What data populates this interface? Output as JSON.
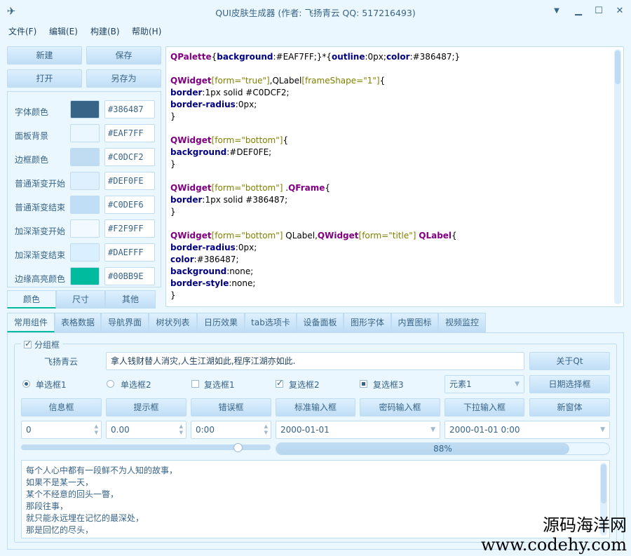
{
  "window": {
    "title": "QUI皮肤生成器 (作者: 飞扬青云  QQ: 517216493)",
    "icons": {
      "app": "airplane-icon",
      "minimize": "minimize-icon",
      "restore": "restore-icon",
      "maximize": "maximize-icon",
      "close": "close-icon"
    }
  },
  "menu": [
    "文件(F)",
    "编辑(E)",
    "构建(B)",
    "帮助(H)"
  ],
  "actions": {
    "new": "新建",
    "save": "保存",
    "open": "打开",
    "save_as": "另存为"
  },
  "colors": [
    {
      "label": "字体颜色",
      "hex": "#386487"
    },
    {
      "label": "面板背景",
      "hex": "#EAF7FF"
    },
    {
      "label": "边框颜色",
      "hex": "#C0DCF2"
    },
    {
      "label": "普通渐变开始",
      "hex": "#DEF0FE"
    },
    {
      "label": "普通渐变结束",
      "hex": "#C0DEF6"
    },
    {
      "label": "加深渐变开始",
      "hex": "#F2F9FF"
    },
    {
      "label": "加深渐变结束",
      "hex": "#DAEFFF"
    },
    {
      "label": "边缘高亮颜色",
      "hex": "#00BB9E"
    }
  ],
  "left_tabs": [
    "颜色",
    "尺寸",
    "其他"
  ],
  "code_lines": [
    "QPalette{background:#EAF7FF;}*{outline:0px;color:#386487;}",
    "",
    "QWidget[form=\"true\"],QLabel[frameShape=\"1\"]{",
    "border:1px solid #C0DCF2;",
    "border-radius:0px;",
    "}",
    "",
    "QWidget[form=\"bottom\"]{",
    "background:#DEF0FE;",
    "}",
    "",
    "QWidget[form=\"bottom\"] .QFrame{",
    "border:1px solid #386487;",
    "}",
    "",
    "QWidget[form=\"bottom\"] QLabel,QWidget[form=\"title\"] QLabel{",
    "border-radius:0px;",
    "color:#386487;",
    "background:none;",
    "border-style:none;",
    "}"
  ],
  "main_tabs": [
    "常用组件",
    "表格数据",
    "导航界面",
    "树状列表",
    "日历效果",
    "tab选项卡",
    "设备面板",
    "图形字体",
    "内置图标",
    "视频监控"
  ],
  "group": {
    "title": "分组框",
    "name_label": "飞扬青云",
    "motto": "拿人钱财替人消灾,人生江湖如此,程序江湖亦如此.",
    "about_button": "关于Qt",
    "radio1": "单选框1",
    "radio2": "单选框2",
    "check1": "复选框1",
    "check2": "复选框2",
    "check3": "复选框3",
    "combo_value": "元素1",
    "date_picker_button": "日期选择框",
    "dialog_buttons": [
      "信息框",
      "提示框",
      "错误框",
      "标准输入框",
      "密码输入框",
      "下拉输入框",
      "新窗体"
    ],
    "spin_int": "0",
    "spin_double": "0.00",
    "time_value": "0:00",
    "date_value": "2000-01-01",
    "datetime_value": "2000-01-01 0:00",
    "slider_fraction": 0.87,
    "progress_percent": 88,
    "progress_text": "88%",
    "text_lines": [
      "每个人心中都有一段鲜不为人知的故事，",
      "如果不是某一天，",
      "某个不经意的回头一瞥，",
      "那段往事，",
      "就只能永远埋在记忆的最深处，",
      "那是回忆的尽头，"
    ]
  },
  "watermark": {
    "line1": "源码海洋网",
    "line2": "www.codehy.com"
  }
}
